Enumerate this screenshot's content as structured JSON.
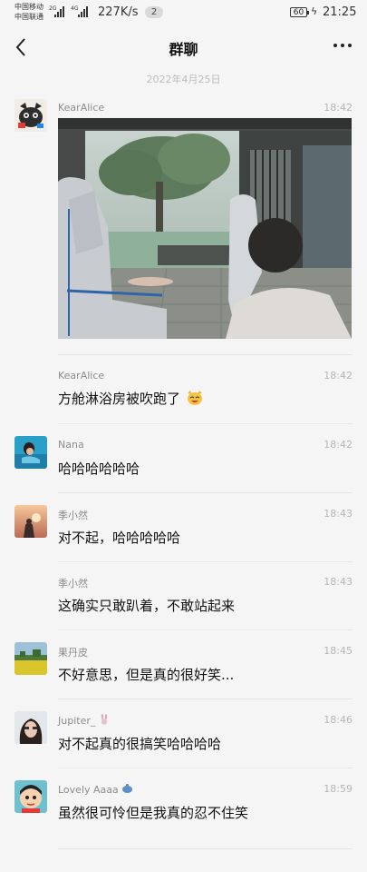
{
  "status_bar": {
    "carrier1": "中国移动",
    "carrier2": "中国联通",
    "net1": "2G",
    "net2": "4G",
    "speed": "227K/s",
    "notif_count": "2",
    "battery": "60",
    "time": "21:25"
  },
  "header": {
    "title": "群聊",
    "back_icon": "chevron-left-icon",
    "more_icon": "more-horizontal-icon"
  },
  "date_separator": "2022年4月25日",
  "messages": [
    {
      "name": "KearAlice",
      "time": "18:42",
      "type": "image"
    },
    {
      "name": "KearAlice",
      "time": "18:42",
      "text": "方舱淋浴房被吹跑了",
      "emoji": "cat-face-icon"
    },
    {
      "name": "Nana",
      "time": "18:42",
      "text": "哈哈哈哈哈哈"
    },
    {
      "name": "季小然",
      "time": "18:43",
      "text": "对不起，哈哈哈哈哈"
    },
    {
      "name": "季小然",
      "time": "18:43",
      "text": "这确实只敢趴着，不敢站起来"
    },
    {
      "name": "果丹皮",
      "time": "18:45",
      "text": "不好意思，但是真的很好笑..."
    },
    {
      "name": "Jupiter_",
      "time": "18:46",
      "text": "对不起真的很搞笑哈哈哈哈"
    },
    {
      "name": "Lovely Aaaa",
      "time": "18:59",
      "text": "虽然很可怜但是我真的忍不住笑"
    }
  ],
  "colors": {
    "background": "#f5f5f5",
    "name": "#8c8c8c",
    "time": "#b5b5b5"
  }
}
